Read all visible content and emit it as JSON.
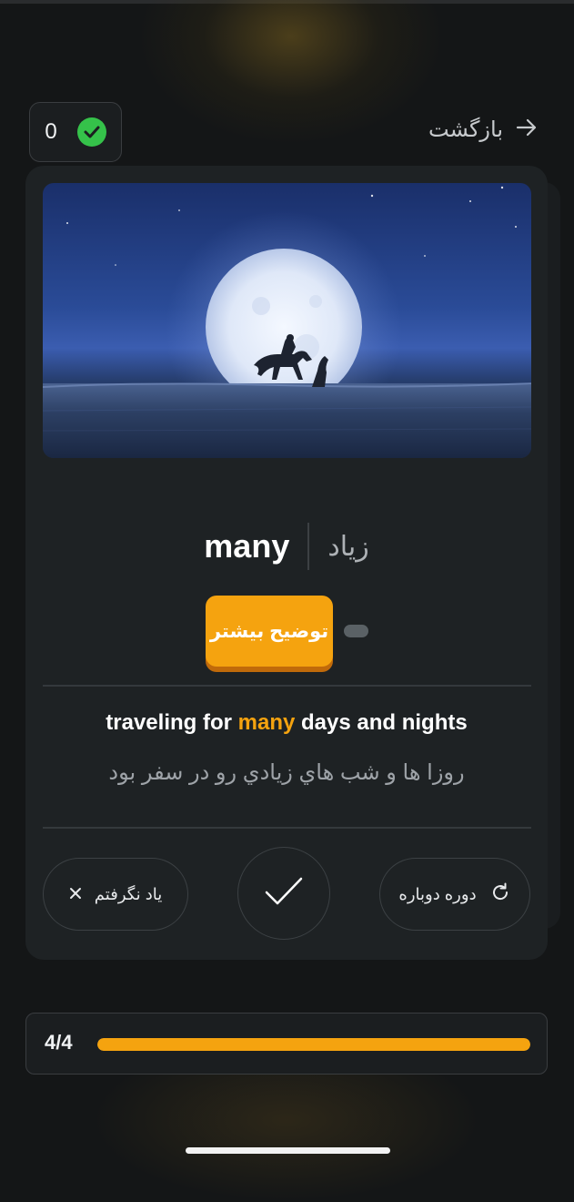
{
  "score": {
    "count": "0"
  },
  "nav": {
    "back_label": "بازگشت"
  },
  "card": {
    "word_en": "many",
    "word_fa": "زیاد",
    "more_button": "توضیح بیشتر",
    "example": {
      "before": "traveling for ",
      "highlight": "many",
      "after": " days and nights",
      "translation": "روزا ها و شب هاي زيادي رو در سفر بود"
    },
    "actions": {
      "forgot_label": "یاد نگرفتم",
      "review_label": "دوره دوباره"
    }
  },
  "progress": {
    "label": "4/4",
    "fraction": 1.0
  },
  "colors": {
    "accent": "#f5a30f",
    "success": "#35c24a",
    "card_bg": "#1e2224",
    "page_bg": "#141617"
  }
}
